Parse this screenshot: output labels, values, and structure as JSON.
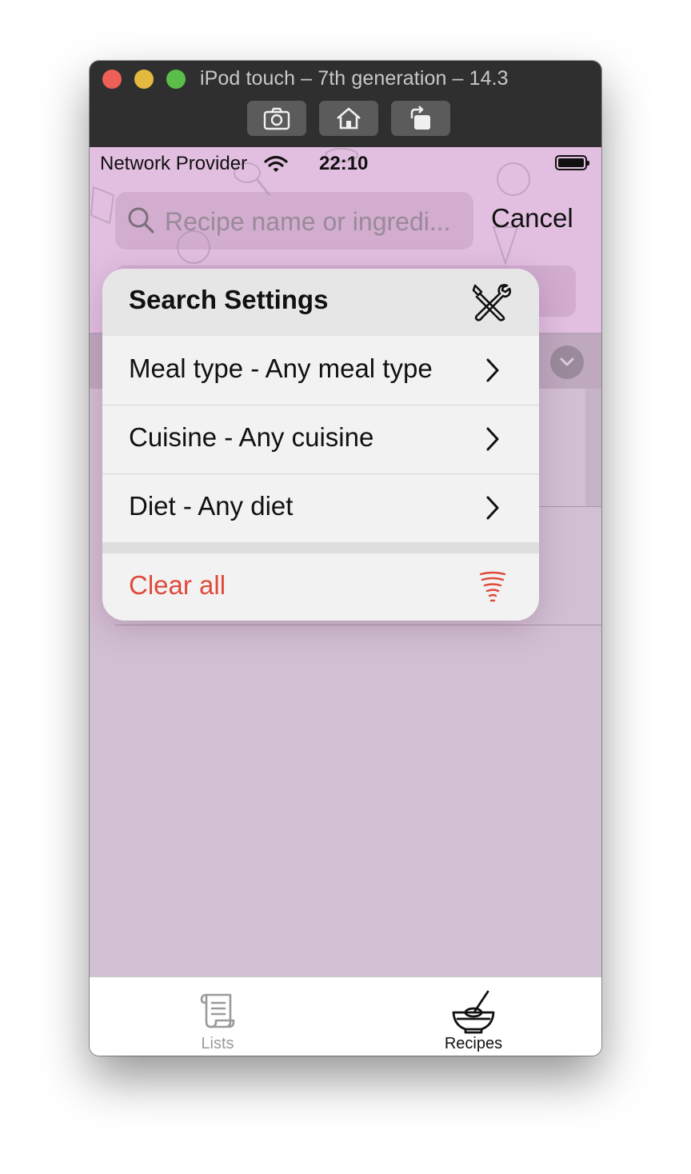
{
  "window": {
    "title": "iPod touch – 7th generation – 14.3",
    "toolbar_icons": [
      "camera-icon",
      "home-icon",
      "rotate-icon"
    ]
  },
  "status_bar": {
    "carrier": "Network Provider",
    "time": "22:10"
  },
  "search": {
    "placeholder": "Recipe name or ingredi...",
    "value": "",
    "cancel_label": "Cancel"
  },
  "search_settings": {
    "title": "Search Settings",
    "items": [
      {
        "label": "Meal type - Any meal type"
      },
      {
        "label": "Cuisine - Any cuisine"
      },
      {
        "label": "Diet - Any diet"
      }
    ],
    "clear_label": "Clear all"
  },
  "tab_bar": {
    "tabs": [
      {
        "label": "Lists",
        "icon": "scroll-icon",
        "selected": false
      },
      {
        "label": "Recipes",
        "icon": "mixing-bowl-icon",
        "selected": true
      }
    ]
  },
  "colors": {
    "accent_red": "#e04a3b",
    "header_pink": "#e2bfe0",
    "dimmed_background": "#d3bfd3"
  }
}
